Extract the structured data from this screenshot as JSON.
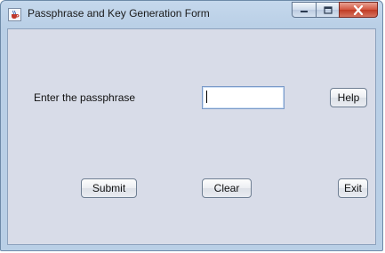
{
  "window": {
    "title": "Passphrase and Key Generation Form",
    "icon": "java-coffee-cup-icon",
    "caption_buttons": [
      "minimize",
      "maximize",
      "close"
    ]
  },
  "form": {
    "passphrase_label": "Enter the passphrase",
    "passphrase_value": "",
    "help_label": "Help",
    "submit_label": "Submit",
    "clear_label": "Clear",
    "exit_label": "Exit"
  },
  "colors": {
    "title_bar": "#c5d8ec",
    "client_background": "#d8dce8",
    "close_button": "#c7412a"
  }
}
